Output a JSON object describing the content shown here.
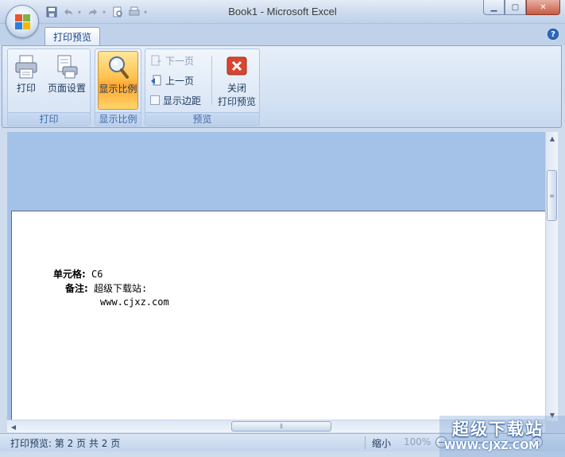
{
  "window": {
    "title": "Book1 - Microsoft Excel",
    "controls": [
      "minimize",
      "maximize",
      "close"
    ]
  },
  "quick_access": [
    "save-icon",
    "undo-icon",
    "redo-icon",
    "print-preview-icon",
    "customize-icon"
  ],
  "tabs": [
    {
      "label": "打印预览",
      "active": true
    }
  ],
  "ribbon": {
    "groups": [
      {
        "label": "打印",
        "buttons": [
          {
            "label": "打印",
            "icon": "printer-icon"
          },
          {
            "label": "页面设置",
            "icon": "page-setup-icon"
          }
        ]
      },
      {
        "label": "显示比例",
        "buttons": [
          {
            "label": "显示比例",
            "icon": "magnifier-icon",
            "active": true
          }
        ]
      },
      {
        "label": "预览",
        "small_buttons": [
          {
            "label": "下一页",
            "enabled": false
          },
          {
            "label": "上一页",
            "enabled": true
          },
          {
            "label": "显示边距",
            "type": "checkbox",
            "checked": false
          }
        ],
        "close_button": {
          "line1": "关闭",
          "line2": "打印预览",
          "icon": "close-x-icon"
        }
      }
    ]
  },
  "page_content": {
    "cell_label": "单元格:",
    "cell_value": "C6",
    "note_label": "备注:",
    "note_line1": "超级下载站:",
    "note_line2": "www.cjxz.com"
  },
  "statusbar": {
    "text": "打印预览: 第 2 页 共 2 页",
    "zoom_label": "缩小",
    "zoom_value": "100%"
  },
  "watermark": {
    "title": "超级下载站",
    "url": "WWW.CJXZ.COM"
  },
  "colors": {
    "accent": "#15428b",
    "ribbon_active": "#ffc24f",
    "close_red": "#d9462f"
  }
}
